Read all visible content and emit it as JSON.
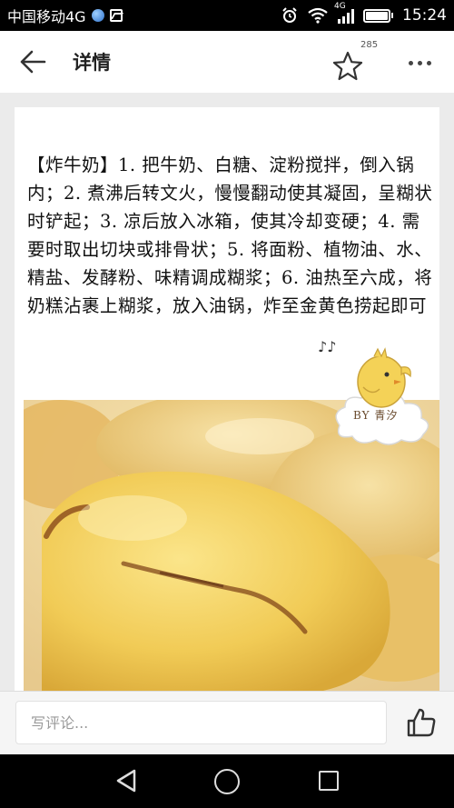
{
  "status_bar": {
    "carrier": "中国移动4G",
    "network_type": "4G",
    "time": "15:24",
    "icons": [
      "globe-icon",
      "image-icon",
      "alarm-icon",
      "wifi-icon",
      "signal-icon",
      "battery-icon"
    ]
  },
  "header": {
    "title": "详情",
    "favorite_count": "285",
    "icons": [
      "back-arrow-icon",
      "star-icon",
      "more-icon"
    ]
  },
  "article": {
    "recipe_text": "【炸牛奶】1. 把牛奶、白糖、淀粉搅拌，倒入锅内；2. 煮沸后转文火，慢慢翻动使其凝固，呈糊状时铲起；3. 凉后放入冰箱，使其冷却变硬；4. 需要时取出切块或排骨状；5. 将面粉、植物油、水、精盐、发酵粉、味精调成糊浆；6. 油热至六成，将奶糕沾裹上糊浆，放入油锅，炸至金黄色捞起即可",
    "watermark_text": "BY 青汐"
  },
  "comment": {
    "placeholder": "写评论..."
  },
  "colors": {
    "status_bar_bg": "#000000",
    "header_bg": "#ffffff",
    "content_bg": "#ebebeb",
    "chick_yellow": "#f4d257"
  }
}
